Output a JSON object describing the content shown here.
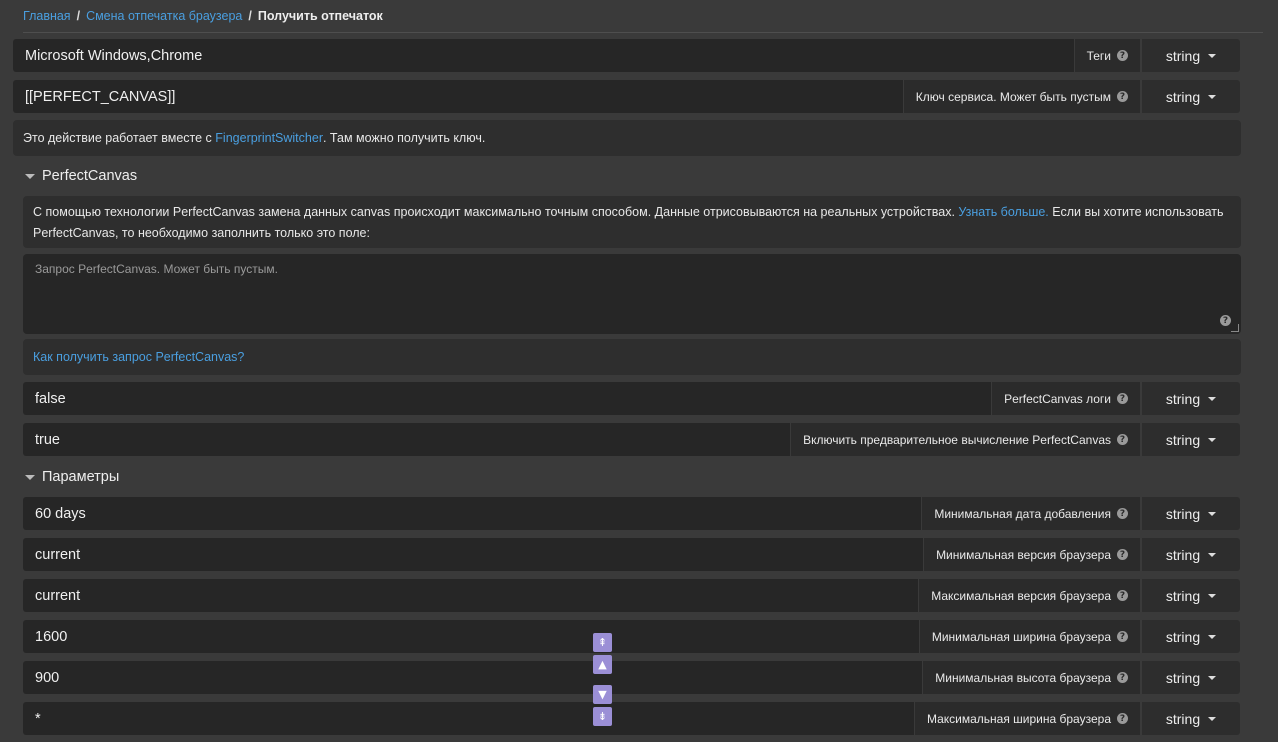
{
  "breadcrumb": {
    "home": "Главная",
    "parent": "Смена отпечатка браузера",
    "current": "Получить отпечаток"
  },
  "top_fields": [
    {
      "value": "Microsoft Windows,Chrome",
      "label": "Теги",
      "type": "string"
    },
    {
      "value": "[[PERFECT_CANVAS]]",
      "label": "Ключ сервиса. Может быть пустым",
      "type": "string"
    }
  ],
  "info": {
    "prefix": "Это действие работает вместе с ",
    "link": "FingerprintSwitcher",
    "suffix": ". Там можно получить ключ."
  },
  "perfectcanvas": {
    "title": "PerfectCanvas",
    "desc_prefix": "С помощью технологии PerfectCanvas замена данных canvas происходит максимально точным способом. Данные отрисовываются на реальных устройствах. ",
    "desc_link": "Узнать больше.",
    "desc_suffix": " Если вы хотите использовать PerfectCanvas, то необходимо заполнить только это поле:",
    "textarea_placeholder": "Запрос PerfectCanvas. Может быть пустым.",
    "howto_link": "Как получить запрос PerfectCanvas?",
    "fields": [
      {
        "value": "false",
        "label": "PerfectCanvas логи",
        "type": "string"
      },
      {
        "value": "true",
        "label": "Включить предварительное вычисление PerfectCanvas",
        "type": "string"
      }
    ]
  },
  "params": {
    "title": "Параметры",
    "fields": [
      {
        "value": "60 days",
        "label": "Минимальная дата добавления",
        "type": "string"
      },
      {
        "value": "current",
        "label": "Минимальная версия браузера",
        "type": "string"
      },
      {
        "value": "current",
        "label": "Максимальная версия браузера",
        "type": "string"
      },
      {
        "value": "1600",
        "label": "Минимальная ширина браузера",
        "type": "string"
      },
      {
        "value": "900",
        "label": "Минимальная высота браузера",
        "type": "string"
      },
      {
        "value": "*",
        "label": "Максимальная ширина браузера",
        "type": "string"
      }
    ]
  },
  "help_icon": "question-circle-icon",
  "scroll_buttons": [
    "scroll-top-icon",
    "scroll-up-icon",
    "scroll-down-icon",
    "scroll-bottom-icon"
  ]
}
